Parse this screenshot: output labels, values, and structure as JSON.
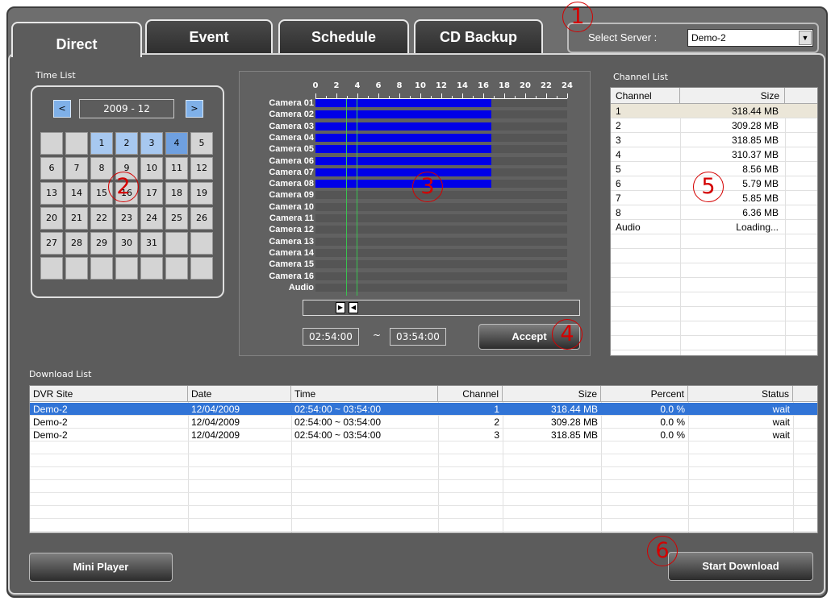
{
  "tabs": [
    {
      "label": "Direct",
      "active": true
    },
    {
      "label": "Event",
      "active": false
    },
    {
      "label": "Schedule",
      "active": false
    },
    {
      "label": "CD Backup",
      "active": false
    }
  ],
  "server": {
    "label": "Select Server :",
    "value": "Demo-2"
  },
  "time_list": {
    "label": "Time List",
    "prev": "<",
    "next": ">",
    "month": "2009 - 12",
    "weeks": [
      [
        "",
        "",
        "1",
        "2",
        "3",
        "4",
        "5"
      ],
      [
        "6",
        "7",
        "8",
        "9",
        "10",
        "11",
        "12"
      ],
      [
        "13",
        "14",
        "15",
        "16",
        "17",
        "18",
        "19"
      ],
      [
        "20",
        "21",
        "22",
        "23",
        "24",
        "25",
        "26"
      ],
      [
        "27",
        "28",
        "29",
        "30",
        "31",
        "",
        ""
      ],
      [
        "",
        "",
        "",
        "",
        "",
        "",
        ""
      ]
    ],
    "highlighted_days": [
      "1",
      "2",
      "3"
    ],
    "selected_day": "4"
  },
  "timeline": {
    "hours": [
      "0",
      "2",
      "4",
      "6",
      "8",
      "10",
      "12",
      "14",
      "16",
      "18",
      "20",
      "22",
      "24"
    ],
    "rows": [
      "Camera 01",
      "Camera 02",
      "Camera 03",
      "Camera 04",
      "Camera 05",
      "Camera 06",
      "Camera 07",
      "Camera 08",
      "Camera 09",
      "Camera 10",
      "Camera 11",
      "Camera 12",
      "Camera 13",
      "Camera 14",
      "Camera 15",
      "Camera 16",
      "Audio"
    ],
    "recorded_until_hour": 16.8,
    "recorded_rows": 8,
    "cursor_hours": [
      2.9,
      3.9
    ],
    "start_time": "02:54:00",
    "tilde": "~",
    "end_time": "03:54:00",
    "accept_label": "Accept",
    "handle_left": "▶",
    "handle_right": "◀"
  },
  "channel_list": {
    "label": "Channel List",
    "headers": [
      "Channel",
      "Size"
    ],
    "rows": [
      {
        "channel": "1",
        "size": "318.44 MB"
      },
      {
        "channel": "2",
        "size": "309.28 MB"
      },
      {
        "channel": "3",
        "size": "318.85 MB"
      },
      {
        "channel": "4",
        "size": "310.37 MB"
      },
      {
        "channel": "5",
        "size": "8.56 MB"
      },
      {
        "channel": "6",
        "size": "5.79 MB"
      },
      {
        "channel": "7",
        "size": "5.85 MB"
      },
      {
        "channel": "8",
        "size": "6.36 MB"
      },
      {
        "channel": "Audio",
        "size": "Loading..."
      }
    ]
  },
  "download_list": {
    "label": "Download List",
    "headers": [
      "DVR Site",
      "Date",
      "Time",
      "Channel",
      "Size",
      "Percent",
      "Status"
    ],
    "rows": [
      {
        "site": "Demo-2",
        "date": "12/04/2009",
        "time": "02:54:00 ~ 03:54:00",
        "channel": "1",
        "size": "318.44 MB",
        "percent": "0.0 %",
        "status": "wait"
      },
      {
        "site": "Demo-2",
        "date": "12/04/2009",
        "time": "02:54:00 ~ 03:54:00",
        "channel": "2",
        "size": "309.28 MB",
        "percent": "0.0 %",
        "status": "wait"
      },
      {
        "site": "Demo-2",
        "date": "12/04/2009",
        "time": "02:54:00 ~ 03:54:00",
        "channel": "3",
        "size": "318.85 MB",
        "percent": "0.0 %",
        "status": "wait"
      }
    ]
  },
  "buttons": {
    "mini_player": "Mini Player",
    "start_download": "Start Download"
  },
  "callouts": [
    "1",
    "2",
    "3",
    "4",
    "5",
    "6"
  ],
  "colors": {
    "recorded_bar": "#0000e8",
    "cursor_line": "#39c24f",
    "selected_row": "#3174d6",
    "callout": "#d40000"
  }
}
